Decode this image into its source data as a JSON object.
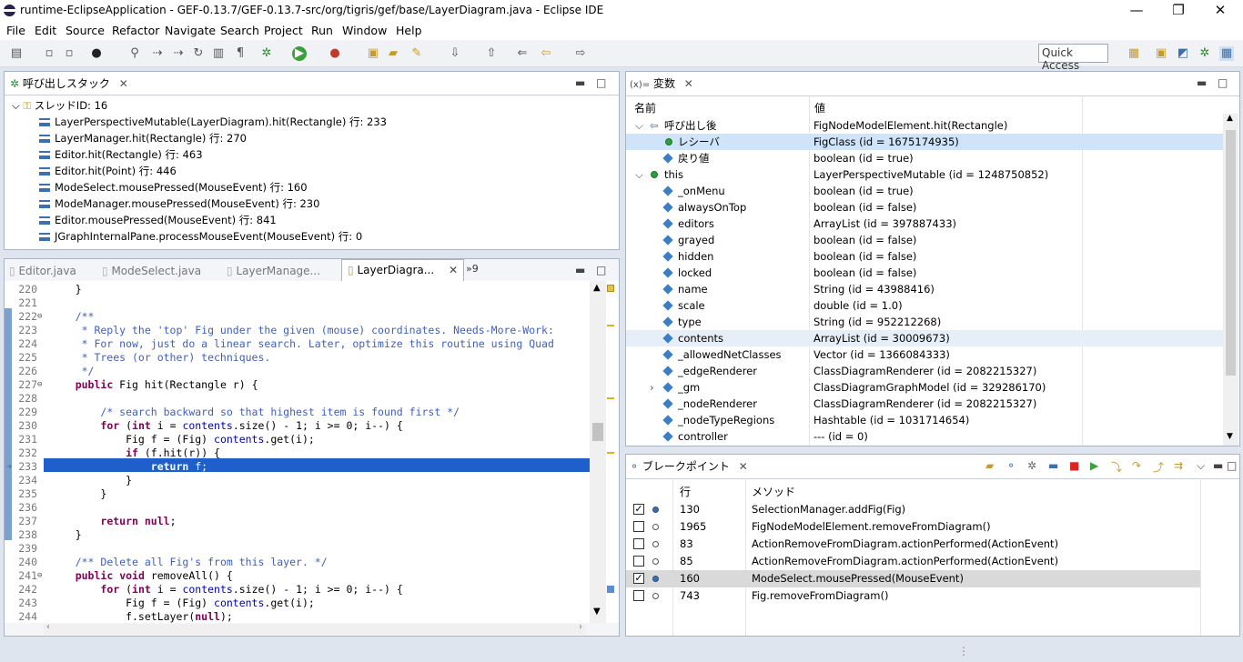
{
  "window": {
    "title": "runtime-EclipseApplication - GEF-0.13.7/GEF-0.13.7-src/org/tigris/gef/base/LayerDiagram.java - Eclipse IDE",
    "min": "—",
    "restore": "❐",
    "close": "✕"
  },
  "menu": [
    "File",
    "Edit",
    "Source",
    "Refactor",
    "Navigate",
    "Search",
    "Project",
    "Run",
    "Window",
    "Help"
  ],
  "quick_access": "Quick Access",
  "callstack": {
    "title": "呼び出しスタック",
    "thread": "スレッドID: 16",
    "frames": [
      "LayerPerspectiveMutable(LayerDiagram).hit(Rectangle) 行: 233",
      "LayerManager.hit(Rectangle) 行: 270",
      "Editor.hit(Rectangle) 行: 463",
      "Editor.hit(Point) 行: 446",
      "ModeSelect.mousePressed(MouseEvent) 行: 160",
      "ModeManager.mousePressed(MouseEvent) 行: 230",
      "Editor.mousePressed(MouseEvent) 行: 841",
      "JGraphInternalPane.processMouseEvent(MouseEvent) 行: 0"
    ]
  },
  "editor": {
    "tabs": [
      "Editor.java",
      "ModeSelect.java",
      "LayerManage...",
      "LayerDiagra..."
    ],
    "overflow": "»9",
    "lines": [
      {
        "n": "220",
        "html": "    }"
      },
      {
        "n": "221",
        "html": ""
      },
      {
        "n": "222",
        "html": "    <span class='cm'>/**</span>"
      },
      {
        "n": "223",
        "html": "<span class='cm'>     * Reply the 'top' Fig under the given (mouse) coordinates. Needs-More-Work:</span>"
      },
      {
        "n": "224",
        "html": "<span class='cm'>     * For now, just do a linear search. Later, optimize this routine using Quad</span>"
      },
      {
        "n": "225",
        "html": "<span class='cm'>     * Trees (or other) techniques.</span>"
      },
      {
        "n": "226",
        "html": "<span class='cm'>     */</span>"
      },
      {
        "n": "227",
        "html": "    <span class='kw'>public</span> Fig hit(Rectangle r) {"
      },
      {
        "n": "228",
        "html": ""
      },
      {
        "n": "229",
        "html": "        <span class='cm'>/* search backward so that highest item is found first */</span>"
      },
      {
        "n": "230",
        "html": "        <span class='kw'>for</span> (<span class='kw'>int</span> i = <span class='fld'>contents</span>.size() - 1; i &gt;= 0; i--) {"
      },
      {
        "n": "231",
        "html": "            Fig f = (Fig) <span class='fld'>contents</span>.get(i);"
      },
      {
        "n": "232",
        "html": "            <span class='kw'>if</span> (f.hit(r)) {"
      },
      {
        "n": "233",
        "html": "                <span style='font-weight:bold'>return</span> f;"
      },
      {
        "n": "234",
        "html": "            }"
      },
      {
        "n": "235",
        "html": "        }"
      },
      {
        "n": "236",
        "html": ""
      },
      {
        "n": "237",
        "html": "        <span class='kw'>return</span> <span class='kw'>null</span>;"
      },
      {
        "n": "238",
        "html": "    }"
      },
      {
        "n": "239",
        "html": ""
      },
      {
        "n": "240",
        "html": "    <span class='cm'>/** Delete all Fig's from this layer. */</span>"
      },
      {
        "n": "241",
        "html": "    <span class='kw'>public</span> <span class='kw'>void</span> removeAll() {"
      },
      {
        "n": "242",
        "html": "        <span class='kw'>for</span> (<span class='kw'>int</span> i = <span class='fld'>contents</span>.size() - 1; i &gt;= 0; i--) {"
      },
      {
        "n": "243",
        "html": "            Fig f = (Fig) <span class='fld'>contents</span>.get(i);"
      },
      {
        "n": "244",
        "html": "            f.setLayer(<span class='kw'>null</span>);"
      }
    ]
  },
  "variables": {
    "title": "変数",
    "col_name": "名前",
    "col_value": "値",
    "rows": [
      {
        "name": "呼び出し後",
        "value": "FigNodeModelElement.hit(Rectangle)",
        "icon": "return",
        "exp": "v"
      },
      {
        "name": "レシーバ",
        "value": "FigClass (id = 1675174935)",
        "icon": "green",
        "sel": true
      },
      {
        "name": "戻り値",
        "value": "boolean (id = true)",
        "icon": "dia"
      },
      {
        "name": "this",
        "value": "LayerPerspectiveMutable (id = 1248750852)",
        "icon": "green",
        "exp": "v",
        "lvl": 0
      },
      {
        "name": "_onMenu",
        "value": "boolean (id = true)",
        "icon": "dia"
      },
      {
        "name": "alwaysOnTop",
        "value": "boolean (id = false)",
        "icon": "dia"
      },
      {
        "name": "editors",
        "value": "ArrayList (id = 397887433)",
        "icon": "dia"
      },
      {
        "name": "grayed",
        "value": "boolean (id = false)",
        "icon": "dia"
      },
      {
        "name": "hidden",
        "value": "boolean (id = false)",
        "icon": "dia"
      },
      {
        "name": "locked",
        "value": "boolean (id = false)",
        "icon": "dia"
      },
      {
        "name": "name",
        "value": "String (id = 43988416)",
        "icon": "dia"
      },
      {
        "name": "scale",
        "value": "double (id = 1.0)",
        "icon": "dia"
      },
      {
        "name": "type",
        "value": "String (id = 952212268)",
        "icon": "dia"
      },
      {
        "name": "contents",
        "value": "ArrayList (id = 30009673)",
        "icon": "dia",
        "hl": true
      },
      {
        "name": "_allowedNetClasses",
        "value": "Vector (id = 1366084333)",
        "icon": "dia"
      },
      {
        "name": "_edgeRenderer",
        "value": "ClassDiagramRenderer (id = 2082215327)",
        "icon": "dia"
      },
      {
        "name": "_gm",
        "value": "ClassDiagramGraphModel (id = 329286170)",
        "icon": "dia",
        "exp": ">"
      },
      {
        "name": "_nodeRenderer",
        "value": "ClassDiagramRenderer (id = 2082215327)",
        "icon": "dia"
      },
      {
        "name": "_nodeTypeRegions",
        "value": "Hashtable (id = 1031714654)",
        "icon": "dia"
      },
      {
        "name": "controller",
        "value": "--- (id = 0)",
        "icon": "dia"
      }
    ]
  },
  "breakpoints": {
    "title": "ブレークポイント",
    "col_line": "行",
    "col_method": "メソッド",
    "rows": [
      {
        "checked": true,
        "line": "130",
        "method": "SelectionManager.addFig(Fig)"
      },
      {
        "checked": false,
        "line": "1965",
        "method": "FigNodeModelElement.removeFromDiagram()"
      },
      {
        "checked": false,
        "line": "83",
        "method": "ActionRemoveFromDiagram.actionPerformed(ActionEvent)"
      },
      {
        "checked": false,
        "line": "85",
        "method": "ActionRemoveFromDiagram.actionPerformed(ActionEvent)"
      },
      {
        "checked": true,
        "line": "160",
        "method": "ModeSelect.mousePressed(MouseEvent)",
        "sel": true
      },
      {
        "checked": false,
        "line": "743",
        "method": "Fig.removeFromDiagram()"
      }
    ]
  }
}
